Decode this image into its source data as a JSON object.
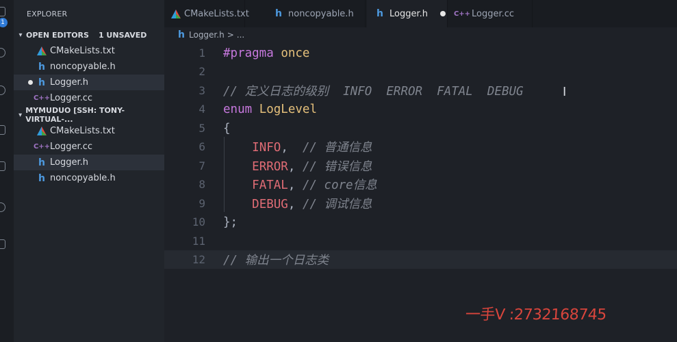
{
  "activity_bar": {
    "badge_count": "1"
  },
  "sidebar": {
    "title": "EXPLORER",
    "open_editors": {
      "label": "OPEN EDITORS",
      "unsaved": "1 UNSAVED",
      "files": [
        {
          "name": "CMakeLists.txt",
          "icon": "cmake-icon"
        },
        {
          "name": "noncopyable.h",
          "icon": "header-file-icon"
        },
        {
          "name": "Logger.h",
          "icon": "header-file-icon",
          "dirty": true
        },
        {
          "name": "Logger.cc",
          "icon": "cpp-file-icon"
        }
      ]
    },
    "workspace": {
      "label": "MYMUDUO [SSH: TONY-VIRTUAL-...",
      "files": [
        {
          "name": "CMakeLists.txt",
          "icon": "cmake-icon"
        },
        {
          "name": "Logger.cc",
          "icon": "cpp-file-icon"
        },
        {
          "name": "Logger.h",
          "icon": "header-file-icon",
          "active": true
        },
        {
          "name": "noncopyable.h",
          "icon": "header-file-icon"
        }
      ]
    }
  },
  "tabs": [
    {
      "label": "CMakeLists.txt",
      "icon": "cmake-icon"
    },
    {
      "label": "noncopyable.h",
      "icon": "header-file-icon"
    },
    {
      "label": "Logger.h",
      "icon": "header-file-icon",
      "active": true,
      "dirty": true
    },
    {
      "label": "Logger.cc",
      "icon": "cpp-file-icon"
    }
  ],
  "breadcrumb": {
    "file": "Logger.h",
    "sep": ">",
    "more": "..."
  },
  "code": {
    "line_numbers": [
      "1",
      "2",
      "3",
      "4",
      "5",
      "6",
      "7",
      "8",
      "9",
      "10",
      "11",
      "12"
    ],
    "l1_a": "#pragma",
    "l1_b": "once",
    "l3": "// 定义日志的级别  INFO  ERROR  FATAL  DEBUG",
    "l4_a": "enum",
    "l4_b": "LogLevel",
    "l5": "{",
    "l6_a": "INFO",
    "l6_b": ",",
    "l6_c": "// 普通信息",
    "l7_a": "ERROR",
    "l7_b": ",",
    "l7_c": "// 错误信息",
    "l8_a": "FATAL",
    "l8_b": ",",
    "l8_c": "// core信息",
    "l9_a": "DEBUG",
    "l9_b": ",",
    "l9_c": "// 调试信息",
    "l10": "};",
    "l12": "// 输出一个日志类"
  },
  "watermark": "一手V :2732168745",
  "colors": {
    "accent": "#2f7ad6",
    "keyword": "#c678dd",
    "type": "#e5c07b",
    "enum_member": "#e06c75",
    "comment": "#7f848e"
  }
}
